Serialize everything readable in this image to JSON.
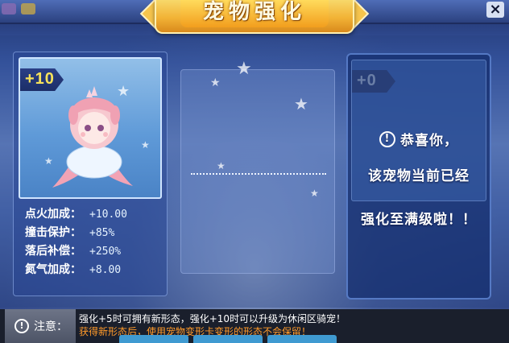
{
  "window": {
    "title": "宠物强化",
    "close_glyph": "×"
  },
  "pet_card": {
    "level": "+10",
    "stats": [
      {
        "label": "点火加成：",
        "value": "+10.00"
      },
      {
        "label": "撞击保护：",
        "value": "+85%"
      },
      {
        "label": "落后补偿：",
        "value": "+250%"
      },
      {
        "label": "氮气加成：",
        "value": "+8.00"
      }
    ]
  },
  "result_card": {
    "level": "+0",
    "message_icon": "!",
    "message_line1": "恭喜你，",
    "message_line2": "该宠物当前已经",
    "message_line3": "强化至满级啦！！"
  },
  "notice": {
    "icon": "!",
    "label": "注意：",
    "line1": "强化+5时可拥有新形态，强化+10时可以升级为休闲区骑宠！",
    "line2": "获得新形态后，使用宠物变形卡变形的形态不会保留！"
  },
  "colors": {
    "title_gold": "#f2b336",
    "level_yellow": "#f7e25a",
    "notice_orange": "#ff9a2a"
  }
}
